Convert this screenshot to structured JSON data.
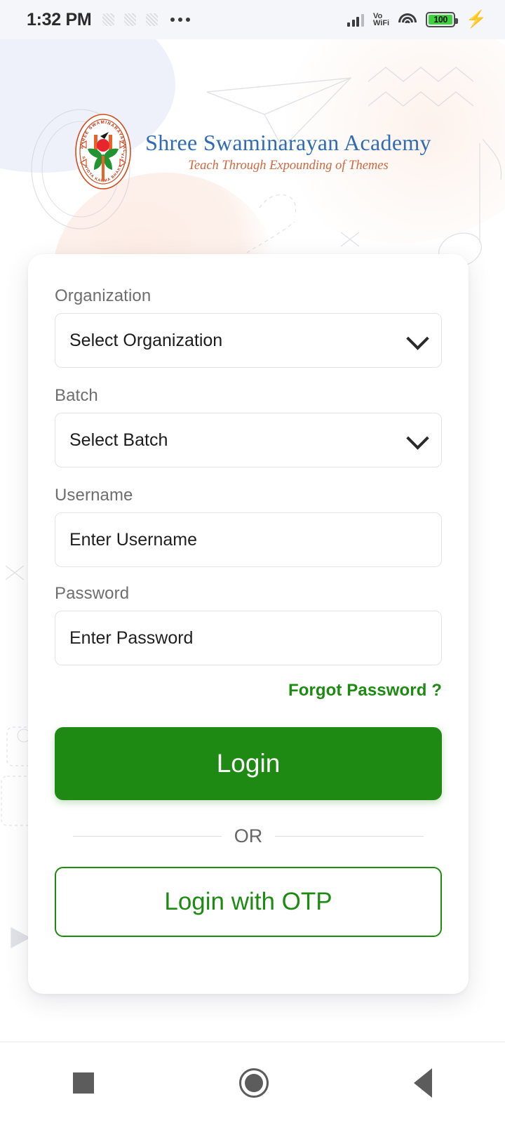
{
  "status_bar": {
    "time": "1:32 PM",
    "overflow_icon": "more-horizontal-icon",
    "signal_icon": "cellular-signal-icon",
    "volte_line1": "Vo",
    "volte_line2": "WiFi",
    "wifi_icon": "wifi-icon",
    "battery_level": "100",
    "charging_icon": "lightning-bolt-icon"
  },
  "brand": {
    "logo_icon": "academy-seal-logo",
    "title": "Shree Swaminarayan Academy",
    "tagline": "Teach Through Expounding of Themes",
    "title_color": "#2f6cb4",
    "tagline_color": "#d2663f"
  },
  "form": {
    "organization": {
      "label": "Organization",
      "value": "Select Organization",
      "chevron_icon": "chevron-down-icon"
    },
    "batch": {
      "label": "Batch",
      "value": "Select Batch",
      "chevron_icon": "chevron-down-icon"
    },
    "username": {
      "label": "Username",
      "placeholder": "Enter Username",
      "value": ""
    },
    "password": {
      "label": "Password",
      "placeholder": "Enter Password",
      "value": ""
    },
    "forgot_password": "Forgot Password ?",
    "login_button": "Login",
    "divider_text": "OR",
    "otp_button": "Login with OTP",
    "accent_color": "#1f8a13"
  },
  "nav_bar": {
    "recents_icon": "square-recents-icon",
    "home_icon": "circle-home-icon",
    "back_icon": "triangle-back-icon"
  }
}
